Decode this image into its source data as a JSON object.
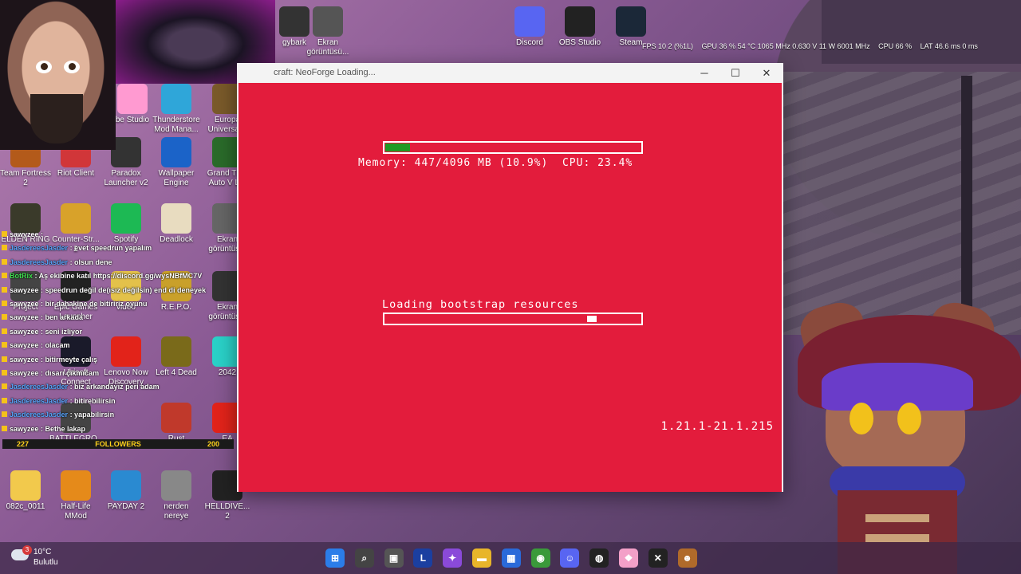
{
  "window": {
    "title": "craft: NeoForge Loading...",
    "minimize": "─",
    "maximize": "☐",
    "close": "✕"
  },
  "splash": {
    "memory_text": "Memory: 447/4096 MB (10.9%)  CPU: 23.4%",
    "memory_fraction": 0.109,
    "loading_text": "Loading bootstrap resources",
    "loading_marker_fraction": 0.8,
    "version": "1.21.1-21.1.215",
    "colors": {
      "background": "#e31c3c",
      "memory_fill": "#1f9b24"
    }
  },
  "stats": {
    "fps": "FPS  10   2 (%1L)",
    "gpu": "GPU 36 %  54 °C  1065 MHz  0.630 V  11 W  6001 MHz",
    "cpu": "CPU 66 %",
    "lat": "LAT 46.6 ms  0 ms"
  },
  "desktop_icons": [
    {
      "label": "gybark",
      "icon": "game-icon",
      "color": "#333"
    },
    {
      "label": "Ekran\ngörüntüsü...",
      "icon": "screenshot-icon",
      "color": "#555"
    },
    {
      "label": "Discord",
      "icon": "discord-icon",
      "color": "#5865f2"
    },
    {
      "label": "OBS Studio",
      "icon": "obs-icon",
      "color": "#222"
    },
    {
      "label": "Steam",
      "icon": "steam-icon",
      "color": "#1b2838"
    },
    {
      "label": "be Studio",
      "icon": "studio-icon",
      "color": "#ff9ad1"
    },
    {
      "label": "Thunderstore\nMod Mana...",
      "icon": "thunderstore-icon",
      "color": "#2fa6d9"
    },
    {
      "label": "Europa\nUniversalis",
      "icon": "europa-icon",
      "color": "#7a5a2a"
    },
    {
      "label": "Team Fortress\n2",
      "icon": "tf2-icon",
      "color": "#b35a1a"
    },
    {
      "label": "Riot Client",
      "icon": "riot-icon",
      "color": "#d13639"
    },
    {
      "label": "Paradox\nLauncher v2",
      "icon": "paradox-icon",
      "color": "#333"
    },
    {
      "label": "Wallpaper\nEngine",
      "icon": "wallpaper-icon",
      "color": "#1b63c8"
    },
    {
      "label": "Grand Th...\nAuto V L...",
      "icon": "gta-icon",
      "color": "#2a6b2a"
    },
    {
      "label": "ELDEN RING",
      "icon": "eldenring-icon",
      "color": "#3a3a2a"
    },
    {
      "label": "Counter-Str...\n2",
      "icon": "cs-icon",
      "color": "#d8a22a"
    },
    {
      "label": "Spotify",
      "icon": "spotify-icon",
      "color": "#1db954"
    },
    {
      "label": "Deadlock",
      "icon": "deadlock-icon",
      "color": "#e8dcc0"
    },
    {
      "label": "Ekran\ngörüntüs...",
      "icon": "screenshot-icon",
      "color": "#666"
    },
    {
      "label": "Project",
      "icon": "project-icon",
      "color": "#444"
    },
    {
      "label": "Epic Games\nLauncher",
      "icon": "epic-icon",
      "color": "#222"
    },
    {
      "label": "video",
      "icon": "folder-icon",
      "color": "#e3c14a"
    },
    {
      "label": "R.E.P.O.",
      "icon": "repo-icon",
      "color": "#c9a02a"
    },
    {
      "label": "Ekran\ngörüntüs...",
      "icon": "screenshot-icon",
      "color": "#333"
    },
    {
      "label": "Ubisoft\nConnect",
      "icon": "ubisoft-icon",
      "color": "#1a1a2a"
    },
    {
      "label": "Lenovo Now\nDiscovery",
      "icon": "lenovo-icon",
      "color": "#e2231a"
    },
    {
      "label": "Left 4 Dead",
      "icon": "l4d-icon",
      "color": "#7a6a1a"
    },
    {
      "label": "2042",
      "icon": "bf-icon",
      "color": "#2ad1c8"
    },
    {
      "label": "BATTLEGRO...",
      "icon": "pubg-icon",
      "color": "#444"
    },
    {
      "label": "Rust",
      "icon": "rust-icon",
      "color": "#c0392b"
    },
    {
      "label": "EA",
      "icon": "ea-icon",
      "color": "#e2231a"
    },
    {
      "label": "082c_0011",
      "icon": "folder-icon",
      "color": "#f2c94c"
    },
    {
      "label": "Half-Life\nMMod",
      "icon": "halflife-icon",
      "color": "#e58a1a"
    },
    {
      "label": "PAYDAY 2",
      "icon": "payday-icon",
      "color": "#2a8ad1"
    },
    {
      "label": "nerden\nnereye",
      "icon": "image-icon",
      "color": "#888"
    },
    {
      "label": "HELLDIVE...\n2",
      "icon": "helldivers-icon",
      "color": "#222"
    }
  ],
  "chat": [
    {
      "user": "sawyzee",
      "text": " :",
      "cls": "u1"
    },
    {
      "user": "JasdereesJasder",
      "text": " : evet speedrun yapalım",
      "cls": "u2"
    },
    {
      "user": "JasdereesJasder",
      "text": " : olsun dene",
      "cls": "u2"
    },
    {
      "user": "BotRix",
      "text": " : Aş ekibine katıl https://discord.gg/wysNBfMC7V",
      "cls": "u3"
    },
    {
      "user": "sawyzee",
      "text": " : speedrun değil de(ısız değilsin) end di deneyek",
      "cls": "u1"
    },
    {
      "user": "sawyzee",
      "text": " : bir dahakine de bitiririz oyunu",
      "cls": "u1"
    },
    {
      "user": "sawyzee",
      "text": " : ben arkada",
      "cls": "u1"
    },
    {
      "user": "sawyzee",
      "text": " : seni izliyor",
      "cls": "u1"
    },
    {
      "user": "sawyzee",
      "text": " : olacam",
      "cls": "u1"
    },
    {
      "user": "sawyzee",
      "text": " : bitirmeyte çalış",
      "cls": "u1"
    },
    {
      "user": "sawyzee",
      "text": " : dısarı çıkmıcam",
      "cls": "u1"
    },
    {
      "user": "JasdereesJasder",
      "text": " : biz arkandayız peri adam",
      "cls": "u2"
    },
    {
      "user": "JasdereesJasder",
      "text": " : bitirebilirsin",
      "cls": "u2"
    },
    {
      "user": "JasdereesJasder",
      "text": " : yapabilirsin",
      "cls": "u2"
    },
    {
      "user": "sawyzee",
      "text": " : Bethe lakap",
      "cls": "u1"
    }
  ],
  "followers": {
    "left": "227",
    "label": "FOLLOWERS",
    "right": "200"
  },
  "weather": {
    "temp": "10°C",
    "desc": "Bulutlu",
    "badge": "3"
  },
  "taskbar": [
    {
      "name": "start-icon",
      "glyph": "⊞",
      "color": "#2b7de9"
    },
    {
      "name": "search-icon",
      "glyph": "⌕",
      "color": "#444"
    },
    {
      "name": "task-view-icon",
      "glyph": "▣",
      "color": "#555"
    },
    {
      "name": "lenovo-icon",
      "glyph": "L",
      "color": "#1b3fa0"
    },
    {
      "name": "copilot-icon",
      "glyph": "✦",
      "color": "#8a4ad9"
    },
    {
      "name": "file-explorer-icon",
      "glyph": "▬",
      "color": "#e8b52a"
    },
    {
      "name": "store-icon",
      "glyph": "▦",
      "color": "#2a6ad9"
    },
    {
      "name": "chrome-icon",
      "glyph": "◉",
      "color": "#3a9a3a"
    },
    {
      "name": "discord-icon",
      "glyph": "☺",
      "color": "#5865f2"
    },
    {
      "name": "obs-icon",
      "glyph": "◍",
      "color": "#222"
    },
    {
      "name": "app-icon",
      "glyph": "❖",
      "color": "#f3a0c8"
    },
    {
      "name": "tool-icon",
      "glyph": "✕",
      "color": "#222"
    },
    {
      "name": "game-icon",
      "glyph": "☻",
      "color": "#b06a2a"
    }
  ]
}
